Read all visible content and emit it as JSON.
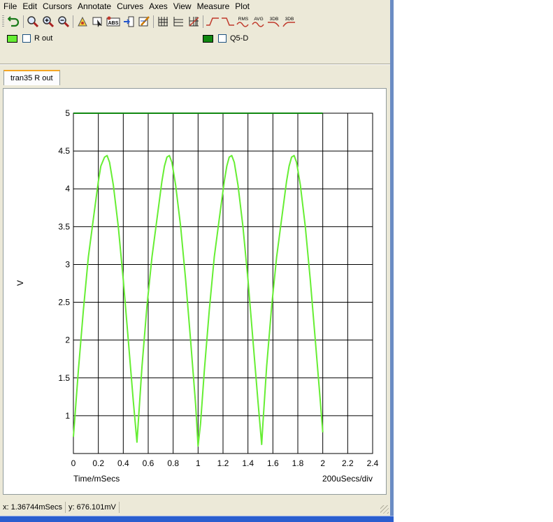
{
  "menu": [
    "File",
    "Edit",
    "Cursors",
    "Annotate",
    "Curves",
    "Axes",
    "View",
    "Measure",
    "Plot"
  ],
  "toolbar": {
    "icons": [
      "undo-icon",
      "zoom-icon",
      "zoom-in-icon",
      "zoom-out-icon",
      "pan-icon",
      "cursor-icon",
      "label-icon",
      "insert-icon",
      "edit-icon",
      "grid-icon",
      "horizontal-grid-icon",
      "log-scale-icon",
      "rise-icon",
      "fall-icon",
      "rms-icon",
      "avg-icon",
      "3db-low-icon",
      "3db-high-icon"
    ],
    "labels": {
      "rms": "RMS",
      "avg": "AVG",
      "db_low": "3DB",
      "db_high": "3DB",
      "abs": "ABS"
    }
  },
  "legend": [
    {
      "name": "R out",
      "color": "#66ee33",
      "checked": false
    },
    {
      "name": "Q5-D",
      "color": "#118811",
      "checked": false
    }
  ],
  "tab": {
    "label": "tran35 R out"
  },
  "status": {
    "x": "x: 1.36744mSecs",
    "y": "y: 676.101mV"
  },
  "chart_data": {
    "type": "line",
    "xlabel": "Time/mSecs",
    "ylabel": "V",
    "scale_note": "200uSecs/div",
    "xlim": [
      0,
      2.4
    ],
    "ylim": [
      0.5,
      5
    ],
    "xticks": [
      "0",
      "0.2",
      "0.4",
      "0.6",
      "0.8",
      "1",
      "1.2",
      "1.4",
      "1.6",
      "1.8",
      "2",
      "2.2",
      "2.4"
    ],
    "yticks": [
      "1",
      "1.5",
      "2",
      "2.5",
      "3",
      "3.5",
      "4",
      "4.5",
      "5"
    ],
    "grid": true,
    "series": [
      {
        "name": "R out",
        "color": "#66ee33",
        "x": [
          0,
          0.04,
          0.08,
          0.12,
          0.16,
          0.2,
          0.22,
          0.25,
          0.27,
          0.29,
          0.32,
          0.36,
          0.4,
          0.44,
          0.48,
          0.51,
          0.52,
          0.55,
          0.59,
          0.63,
          0.67,
          0.71,
          0.73,
          0.75,
          0.77,
          0.79,
          0.82,
          0.86,
          0.9,
          0.94,
          0.98,
          1.0,
          1.02,
          1.05,
          1.09,
          1.13,
          1.17,
          1.21,
          1.23,
          1.25,
          1.27,
          1.29,
          1.32,
          1.36,
          1.4,
          1.44,
          1.48,
          1.51,
          1.52,
          1.55,
          1.59,
          1.63,
          1.67,
          1.71,
          1.73,
          1.75,
          1.77,
          1.79,
          1.82,
          1.86,
          1.9,
          1.94,
          1.98,
          2.0
        ],
        "y": [
          0.72,
          1.6,
          2.4,
          3.1,
          3.6,
          4.1,
          4.3,
          4.42,
          4.44,
          4.35,
          4.05,
          3.5,
          2.8,
          2.0,
          1.2,
          0.65,
          0.9,
          1.65,
          2.45,
          3.1,
          3.6,
          4.1,
          4.3,
          4.42,
          4.44,
          4.35,
          4.05,
          3.5,
          2.8,
          2.0,
          1.15,
          0.6,
          0.9,
          1.6,
          2.4,
          3.1,
          3.6,
          4.1,
          4.3,
          4.42,
          4.44,
          4.35,
          4.05,
          3.5,
          2.8,
          2.0,
          1.2,
          0.62,
          0.9,
          1.65,
          2.45,
          3.1,
          3.6,
          4.1,
          4.3,
          4.42,
          4.44,
          4.35,
          4.05,
          3.5,
          2.8,
          2.0,
          1.2,
          0.78
        ]
      },
      {
        "name": "Q5-D",
        "color": "#118811",
        "x": [
          0,
          2.0
        ],
        "y": [
          5,
          5
        ]
      }
    ]
  }
}
